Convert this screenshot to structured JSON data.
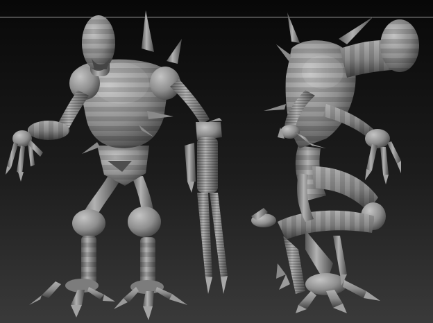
{
  "scene": {
    "subject": "armoured-creature-sculpt",
    "views": [
      "front",
      "three-quarter"
    ],
    "colors": {
      "background_top": "#0b0b0b",
      "background_bottom": "#3a3a3a",
      "divider_line": "#8a8a8a",
      "clay_light": "#b4b4b4",
      "clay_mid": "#8e8e8e",
      "clay_dark": "#575757",
      "clay_shadow": "#2e2e2e"
    }
  }
}
